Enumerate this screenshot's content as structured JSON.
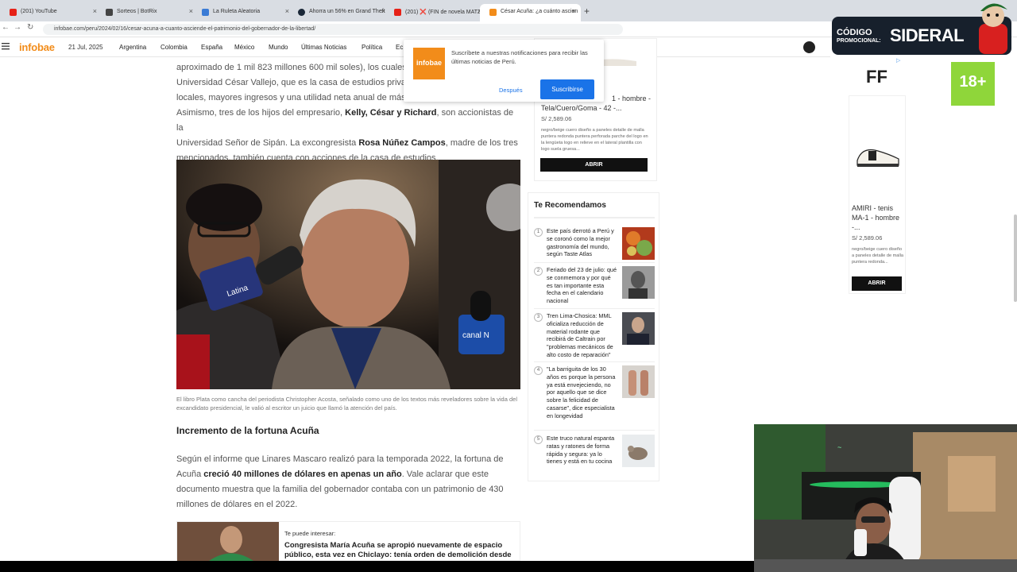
{
  "browser": {
    "tabs": [
      {
        "label": "(201) YouTube",
        "color": "#e62117"
      },
      {
        "label": "Sorteos | BotRix",
        "color": "#444444"
      },
      {
        "label": "La Ruleta Aleatoria",
        "color": "#3a7bd5"
      },
      {
        "label": "Ahorra un 56% en Grand Theft",
        "color": "#1b2838"
      },
      {
        "label": "(201) ❌ (FIN de novela MATZ)",
        "color": "#e62117"
      },
      {
        "label": "César Acuña: ¿a cuánto ascien",
        "color": "#f28c1a"
      }
    ],
    "new_tab": "+",
    "url": "infobae.com/peru/2024/02/16/cesar-acuna-a-cuanto-asciende-el-patrimonio-del-gobernador-de-la-libertad/"
  },
  "site": {
    "logo": "infobae",
    "date": "21 Jul, 2025",
    "nav": [
      "Argentina",
      "Colombia",
      "España",
      "México",
      "Mundo",
      "Últimas Noticias",
      "Política",
      "Ec"
    ]
  },
  "notification": {
    "logo": "infobae",
    "text": "Suscríbete a nuestras notificaciones para recibir las últimas noticias de Perú.",
    "later": "Después",
    "subscribe": "Suscribirse"
  },
  "article": {
    "p1": [
      {
        "t": "aproximado de 1 mil 823 millones 600 mil soles), los cuales"
      },
      {
        "t": "Universidad César Vallejo, que es la casa de estudios privad"
      },
      {
        "t": "locales, mayores ingresos y una utilidad neta anual de más"
      },
      {
        "t": "Asimismo, tres de los hijos del empresario, ",
        "b": "Kelly, César y Richard",
        "t2": ", son accionistas de la"
      },
      {
        "t": "Universidad Señor de Sipán. La excongresista ",
        "b": "Rosa Núñez Campos",
        "t2": ", madre de los tres"
      },
      {
        "t": "mencionados, también cuenta con acciones de la casa de estudios."
      }
    ],
    "mic1": "Latina",
    "mic2": "canal N",
    "caption": "El libro Plata como cancha del periodista Christopher Acosta, señalado como uno de los textos más reveladores sobre la vida del excandidato presidencial, le valió al escritor un juicio que llamó la atención del país.",
    "subhead": "Incremento de la fortuna Acuña",
    "p2": [
      {
        "t": "Según el informe que Linares Mascaro realizó para la temporada 2022, la fortuna de"
      },
      {
        "t": "Acuña ",
        "b": "creció 40 millones de dólares en apenas un año",
        "t2": ". Vale aclarar que este"
      },
      {
        "t": "documento muestra que la familia del gobernador contaba con un patrimonio de 430"
      },
      {
        "t": "millones de dólares en el 2022."
      }
    ],
    "related": {
      "kicker": "Te puede interesar:",
      "title": "Congresista María Acuña se apropió nuevamente de espacio público, esta vez en Chiclayo: tenía orden de demolición desde"
    }
  },
  "ad1": {
    "title": "1 - hombre - Tela/Cuero/Goma - 42 -...",
    "title_prefix": "Tela/Cuero/Goma - 42 -...",
    "title_line1": "1 - hombre -",
    "price": "S/ 2,589.06",
    "desc": "negro/beige cuero diseño a paneles detalle de malla puntera redonda puntera perforada parche del logo en la lengüeta logo en relieve en el lateral plantilla con logo suela gruesa...",
    "button": "ABRIR"
  },
  "recommended": {
    "title": "Te Recomendamos",
    "items": [
      {
        "n": "1",
        "text": "Este país derrotó a Perú y se coronó como la mejor gastronomía del mundo, según Taste Atlas"
      },
      {
        "n": "2",
        "text": "Feriado del 23 de julio: qué se conmemora y por qué es tan importante esta fecha en el calendario nacional"
      },
      {
        "n": "3",
        "text": "Tren Lima-Chosica: MML oficializa reducción de material rodante que recibirá de Caltrain por \"problemas mecánicos de alto costo de reparación\""
      },
      {
        "n": "4",
        "text": "\"La barriguita de los 30 años es porque la persona ya está envejeciendo, no por aquello que se dice sobre la felicidad de casarse\", dice especialista en longevidad"
      },
      {
        "n": "5",
        "text": "Este truco natural espanta ratas y ratones de forma rápida y segura: ya lo tienes y está en tu cocina"
      }
    ]
  },
  "ad2": {
    "brand": "FF",
    "title": "AMIRI - tenis MA-1 - hombre -...",
    "price": "S/ 2,589.06",
    "desc": "negro/beige cuero diseño a paneles detalle de malla puntera redonda...",
    "button": "ABRIR"
  },
  "age_badge": "18+",
  "promo": {
    "line1": "CÓDIGO",
    "line2": "PROMOCIONAL:",
    "code": "SIDERAL"
  }
}
